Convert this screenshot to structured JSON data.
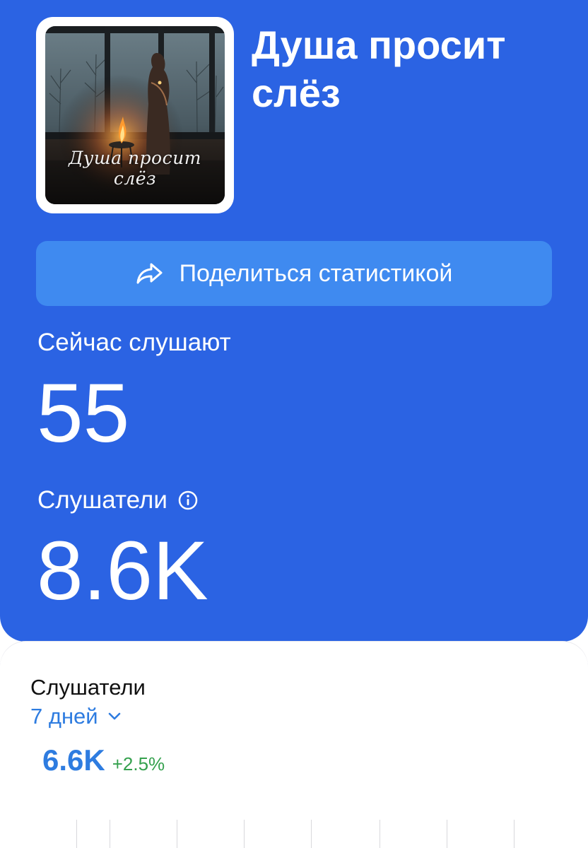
{
  "album": {
    "title": "Душа просит слёз",
    "cover_script": "Душа просит слёз"
  },
  "share": {
    "label": "Поделиться статистикой",
    "icon": "share-arrow-icon"
  },
  "now_listening": {
    "label": "Сейчас слушают",
    "value": "55"
  },
  "listeners": {
    "label": "Слушатели",
    "value": "8.6K",
    "info_icon": "info-icon"
  },
  "stats_card": {
    "title": "Слушатели",
    "period": "7 дней",
    "value": "6.6K",
    "change": "+2.5%"
  },
  "colors": {
    "hero_background": "#2b63e3",
    "share_button": "#3f8af0",
    "accent_blue": "#2e7ce0",
    "positive_green": "#35a14e"
  }
}
